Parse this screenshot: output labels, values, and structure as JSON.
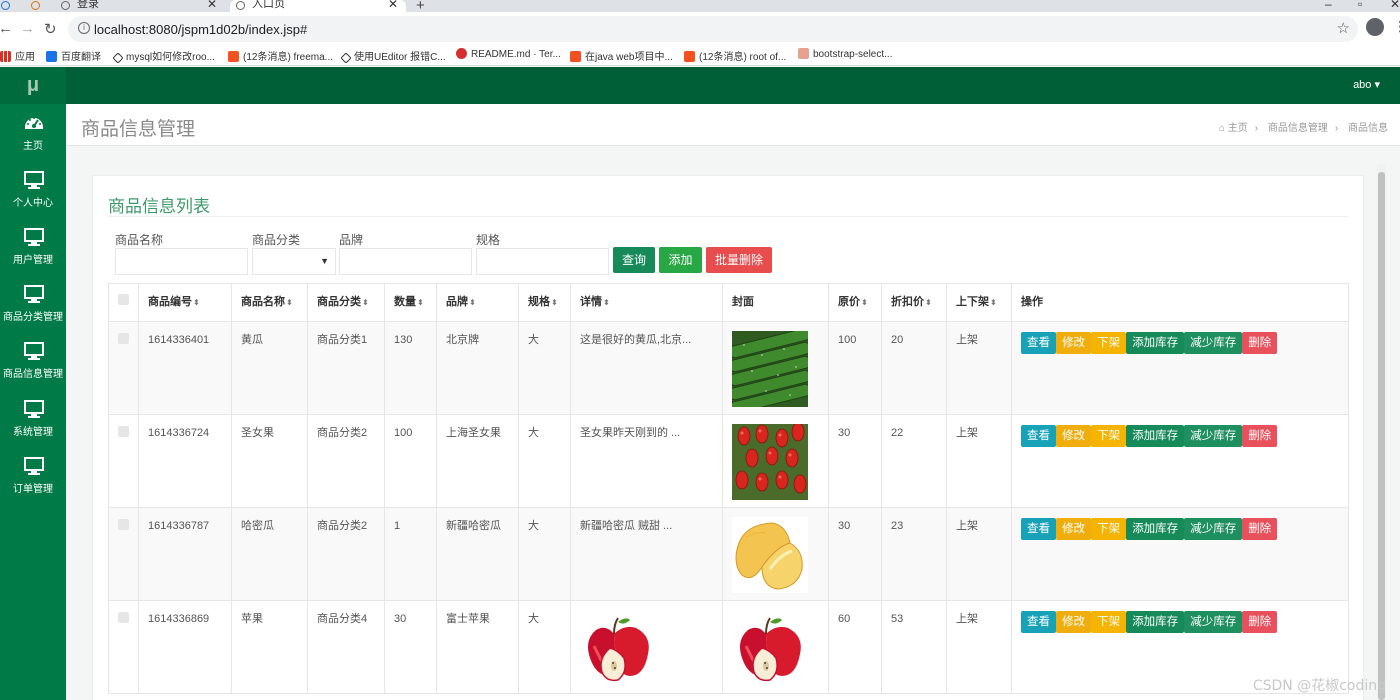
{
  "browser": {
    "tabs": [
      {
        "label": "登录"
      },
      {
        "label": "入口页"
      }
    ],
    "url": "localhost:8080/jspm1d02b/index.jsp#",
    "bookmarks": [
      {
        "label": "应用",
        "icon": "apps-icon"
      },
      {
        "label": "百度翻译",
        "icon": "translate-icon"
      },
      {
        "label": "mysql如何修改roo...",
        "icon": "mysql-icon"
      },
      {
        "label": "(12条消息) freema...",
        "icon": "csdn-icon"
      },
      {
        "label": "使用UEditor 报错C...",
        "icon": "mysql-icon"
      },
      {
        "label": "README.md · Ter...",
        "icon": "gitee-icon"
      },
      {
        "label": "在java web项目中...",
        "icon": "csdn-icon"
      },
      {
        "label": "(12条消息) root of...",
        "icon": "csdn-icon"
      },
      {
        "label": "bootstrap-select...",
        "icon": "bookmark-icon"
      }
    ]
  },
  "app": {
    "logo": "μ",
    "user": "abo ▾",
    "sidebar": [
      {
        "label": "主页",
        "icon": "dashboard-icon"
      },
      {
        "label": "个人中心",
        "icon": "monitor-icon"
      },
      {
        "label": "用户管理",
        "icon": "monitor-icon"
      },
      {
        "label": "商品分类管理",
        "icon": "monitor-icon"
      },
      {
        "label": "商品信息管理",
        "icon": "monitor-icon"
      },
      {
        "label": "系统管理",
        "icon": "monitor-icon"
      },
      {
        "label": "订单管理",
        "icon": "monitor-icon"
      }
    ],
    "page_title": "商品信息管理",
    "breadcrumb": [
      "主页",
      "商品信息管理",
      "商品信息"
    ],
    "colors": {
      "topbar": "#005f36",
      "sidebar": "#007a46",
      "accent": "#3c9a6b"
    }
  },
  "list": {
    "title": "商品信息列表",
    "filters": {
      "name_label": "商品名称",
      "category_label": "商品分类",
      "brand_label": "品牌",
      "spec_label": "规格"
    },
    "buttons": {
      "query": "查询",
      "add": "添加",
      "batch_delete": "批量删除"
    },
    "columns": [
      "商品编号",
      "商品名称",
      "商品分类",
      "数量",
      "品牌",
      "规格",
      "详情",
      "封面",
      "原价",
      "折扣价",
      "上下架",
      "操作"
    ],
    "row_actions": {
      "view": "查看",
      "edit": "修改",
      "unlist": "下架",
      "add_stock": "添加库存",
      "reduce_stock": "减少库存",
      "delete": "删除"
    },
    "rows": [
      {
        "id": "1614336401",
        "name": "黄瓜",
        "category": "商品分类1",
        "qty": "130",
        "brand": "北京牌",
        "spec": "大",
        "detail": "这是很好的黄瓜,北京...",
        "detail_image": null,
        "cover": "cucumber",
        "price": "100",
        "discount": "20",
        "status": "上架"
      },
      {
        "id": "1614336724",
        "name": "圣女果",
        "category": "商品分类2",
        "qty": "100",
        "brand": "上海圣女果",
        "spec": "大",
        "detail": "圣女果昨天刚到的 ...",
        "detail_image": null,
        "cover": "cherry-tomato",
        "price": "30",
        "discount": "22",
        "status": "上架"
      },
      {
        "id": "1614336787",
        "name": "哈密瓜",
        "category": "商品分类2",
        "qty": "1",
        "brand": "新疆哈密瓜",
        "spec": "大",
        "detail": "新疆哈密瓜 贼甜 ...",
        "detail_image": null,
        "cover": "melon",
        "price": "30",
        "discount": "23",
        "status": "上架"
      },
      {
        "id": "1614336869",
        "name": "苹果",
        "category": "商品分类4",
        "qty": "30",
        "brand": "富士苹果",
        "spec": "大",
        "detail": "",
        "detail_image": "apple",
        "cover": "apple",
        "price": "60",
        "discount": "53",
        "status": "上架"
      }
    ]
  },
  "watermark": "CSDN @花椒coding"
}
